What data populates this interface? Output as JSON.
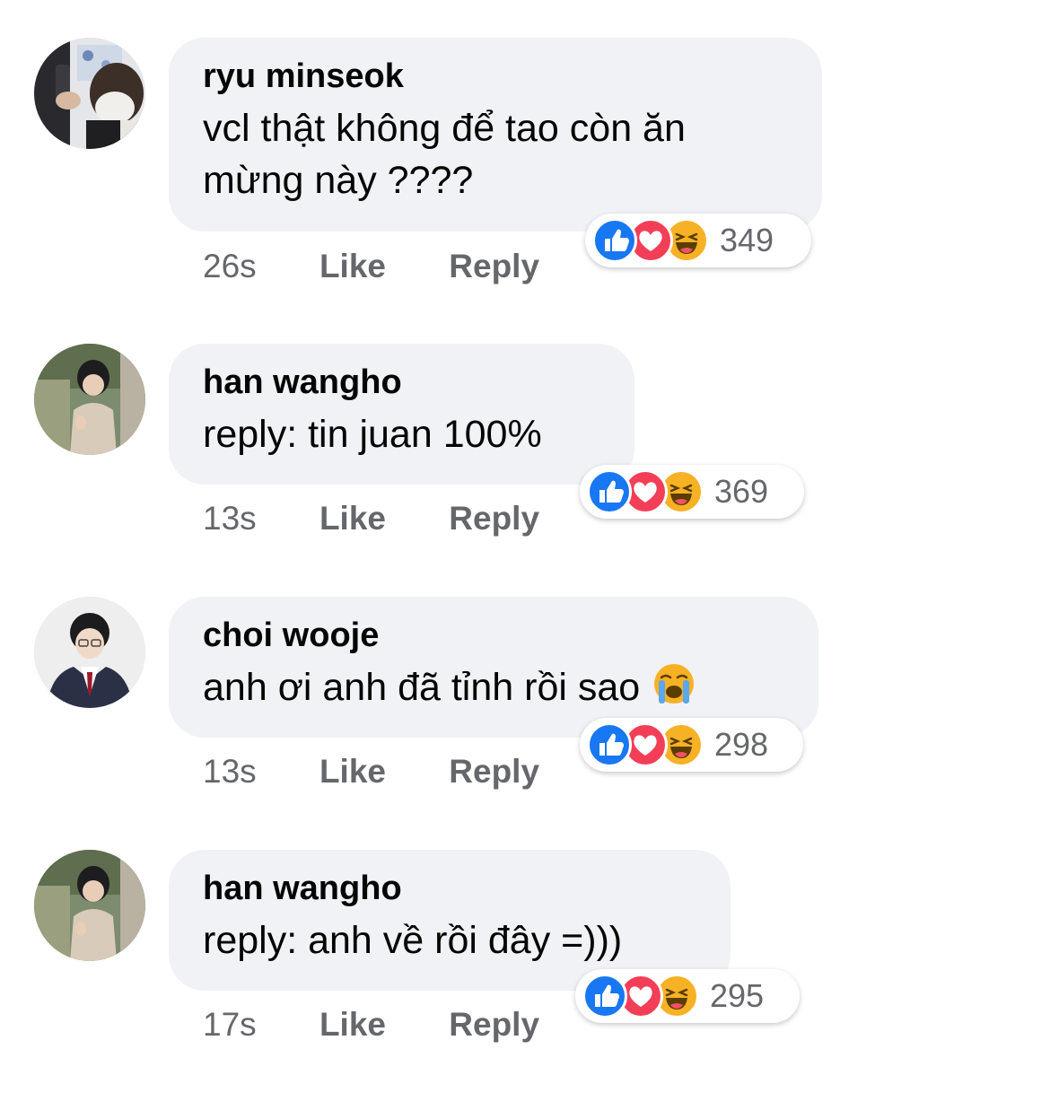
{
  "comments": [
    {
      "author": "ryu minseok",
      "text": "vcl thật không để tao còn ăn mừng này ????",
      "time": "26s",
      "like_label": "Like",
      "reply_label": "Reply",
      "reaction_count": "349",
      "avatar_icon": "profile-photo-phone-mask"
    },
    {
      "author": "han wangho",
      "text": "reply: tin juan 100%",
      "time": "13s",
      "like_label": "Like",
      "reply_label": "Reply",
      "reaction_count": "369",
      "avatar_icon": "profile-photo-outdoor"
    },
    {
      "author": "choi wooje",
      "text": "anh ơi anh đã tỉnh rồi sao",
      "trailing_emoji": "loudly-crying-face",
      "time": "13s",
      "like_label": "Like",
      "reply_label": "Reply",
      "reaction_count": "298",
      "avatar_icon": "profile-photo-uniform"
    },
    {
      "author": "han wangho",
      "text": "reply: anh về rồi đây =)))",
      "time": "17s",
      "like_label": "Like",
      "reply_label": "Reply",
      "reaction_count": "295",
      "avatar_icon": "profile-photo-outdoor"
    }
  ],
  "reaction_icons": [
    "like-icon",
    "love-icon",
    "haha-icon"
  ],
  "colors": {
    "bubble": "#f0f2f5",
    "meta_text": "#65676b",
    "like": "#1877f2",
    "love": "#f33e58",
    "haha": "#f7b125"
  }
}
